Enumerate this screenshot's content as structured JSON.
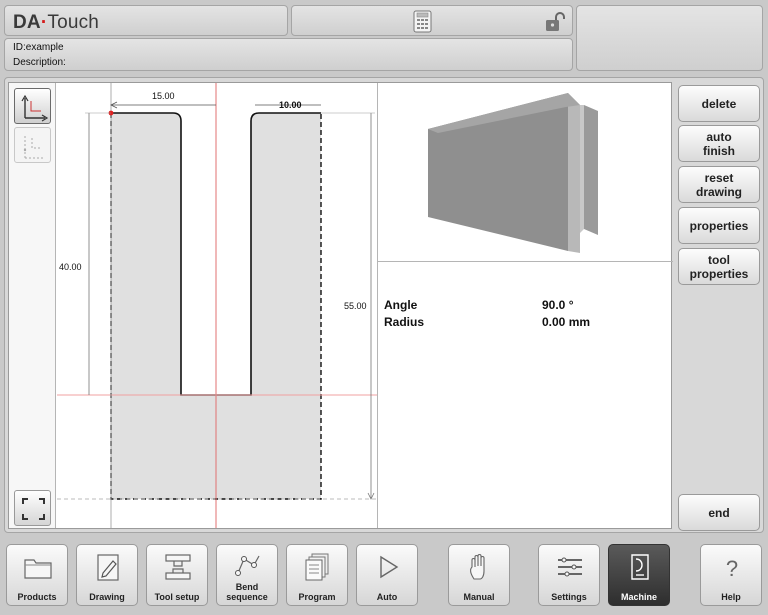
{
  "header": {
    "logo_brand": "DA",
    "logo_dot": "·",
    "logo_product": "Touch",
    "id_line": "ID:example",
    "description_line": "Description:"
  },
  "drawing": {
    "dim_top_left": "15.00",
    "dim_top_right": "10.00",
    "dim_left": "40.00",
    "dim_right": "55.00"
  },
  "properties": {
    "angle_label": "Angle",
    "angle_value": "90.0 °",
    "radius_label": "Radius",
    "radius_value": "0.00 mm"
  },
  "side_buttons": {
    "delete": "delete",
    "auto_finish": "auto\nfinish",
    "reset_drawing": "reset\ndrawing",
    "properties": "properties",
    "tool_properties": "tool\nproperties",
    "end": "end"
  },
  "nav": {
    "products": "Products",
    "drawing": "Drawing",
    "tool_setup": "Tool setup",
    "bend_sequence": "Bend\nsequence",
    "program": "Program",
    "auto": "Auto",
    "manual": "Manual",
    "settings": "Settings",
    "machine": "Machine",
    "help": "Help"
  },
  "colors": {
    "brand_red": "#d41a1a",
    "profile_fill": "#e0e0e0",
    "guide_red": "#e04040",
    "active_tab": "#3a3a3a"
  }
}
